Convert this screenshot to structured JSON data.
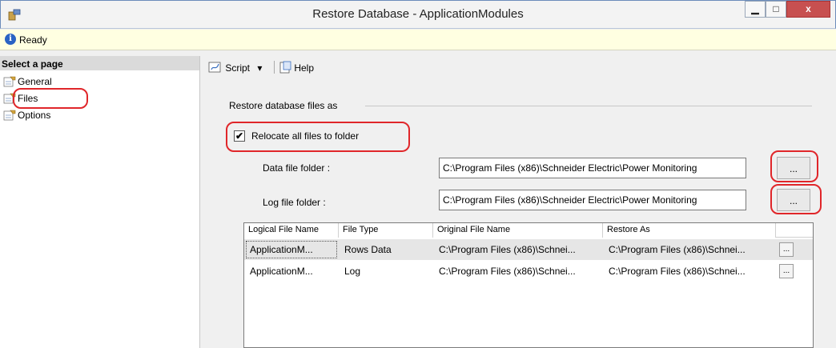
{
  "window": {
    "title": "Restore Database - ApplicationModules",
    "minimize": "▁",
    "maximize": "□",
    "close": "x"
  },
  "status": {
    "text": "Ready"
  },
  "left_pane": {
    "header": "Select a page",
    "items": [
      {
        "label": "General",
        "icon": "page-wrench-icon"
      },
      {
        "label": "Files",
        "icon": "page-wrench-icon",
        "selected": true
      },
      {
        "label": "Options",
        "icon": "page-wrench-icon"
      }
    ]
  },
  "toolbar": {
    "script_label": "Script",
    "script_dropdown": "▾",
    "help_label": "Help"
  },
  "restore_files": {
    "section_label": "Restore database files as",
    "relocate_label": "Relocate all files to folder",
    "relocate_checked": true,
    "data_folder_label": "Data file folder :",
    "data_folder_value": "C:\\Program Files (x86)\\Schneider Electric\\Power Monitoring",
    "log_folder_label": "Log file folder :",
    "log_folder_value": "C:\\Program Files (x86)\\Schneider Electric\\Power Monitoring",
    "browse_label": "..."
  },
  "grid": {
    "columns": [
      "Logical File Name",
      "File Type",
      "Original File Name",
      "Restore As"
    ],
    "rows": [
      [
        "ApplicationM...",
        "Rows Data",
        "C:\\Program Files (x86)\\Schnei...",
        "C:\\Program Files (x86)\\Schnei..."
      ],
      [
        "ApplicationM...",
        "Log",
        "C:\\Program Files (x86)\\Schnei...",
        "C:\\Program Files (x86)\\Schnei..."
      ]
    ],
    "row_button": "..."
  },
  "colors": {
    "highlight": "#e0262a",
    "status_bg": "#ffffe1"
  }
}
